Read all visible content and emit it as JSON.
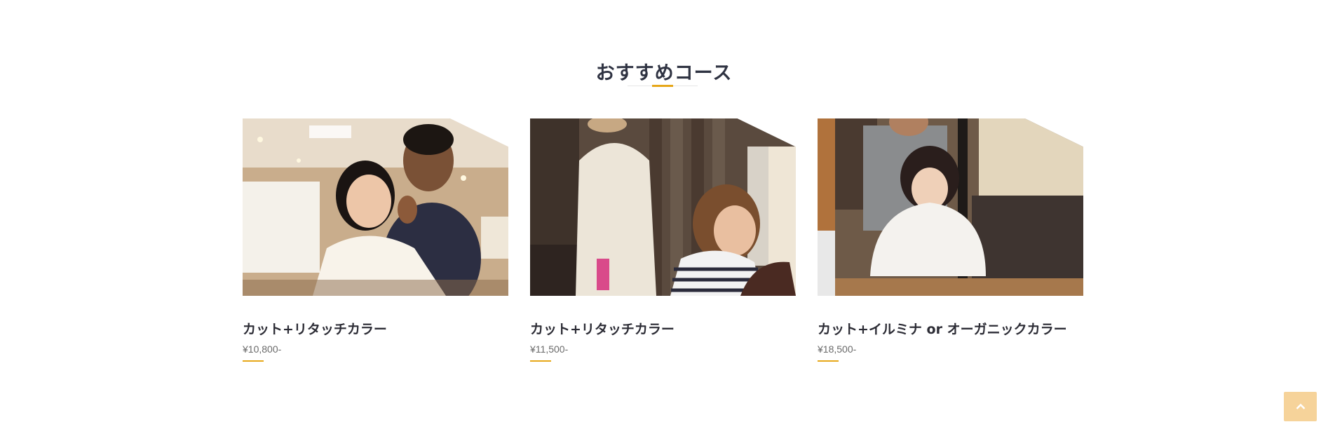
{
  "section": {
    "title": "おすすめコース",
    "accent_color": "#e6a719"
  },
  "courses": [
    {
      "title": "カット+リタッチカラー",
      "price": "¥10,800-",
      "image_icon": "salon-stylist-photo"
    },
    {
      "title": "カット+リタッチカラー",
      "price": "¥11,500-",
      "image_icon": "salon-hair-color-photo"
    },
    {
      "title": "カット+イルミナ or オーガニックカラー",
      "price": "¥18,500-",
      "image_icon": "salon-cut-photo"
    }
  ],
  "back_to_top": {
    "icon": "chevron-up-icon",
    "color": "#f6d39a"
  }
}
